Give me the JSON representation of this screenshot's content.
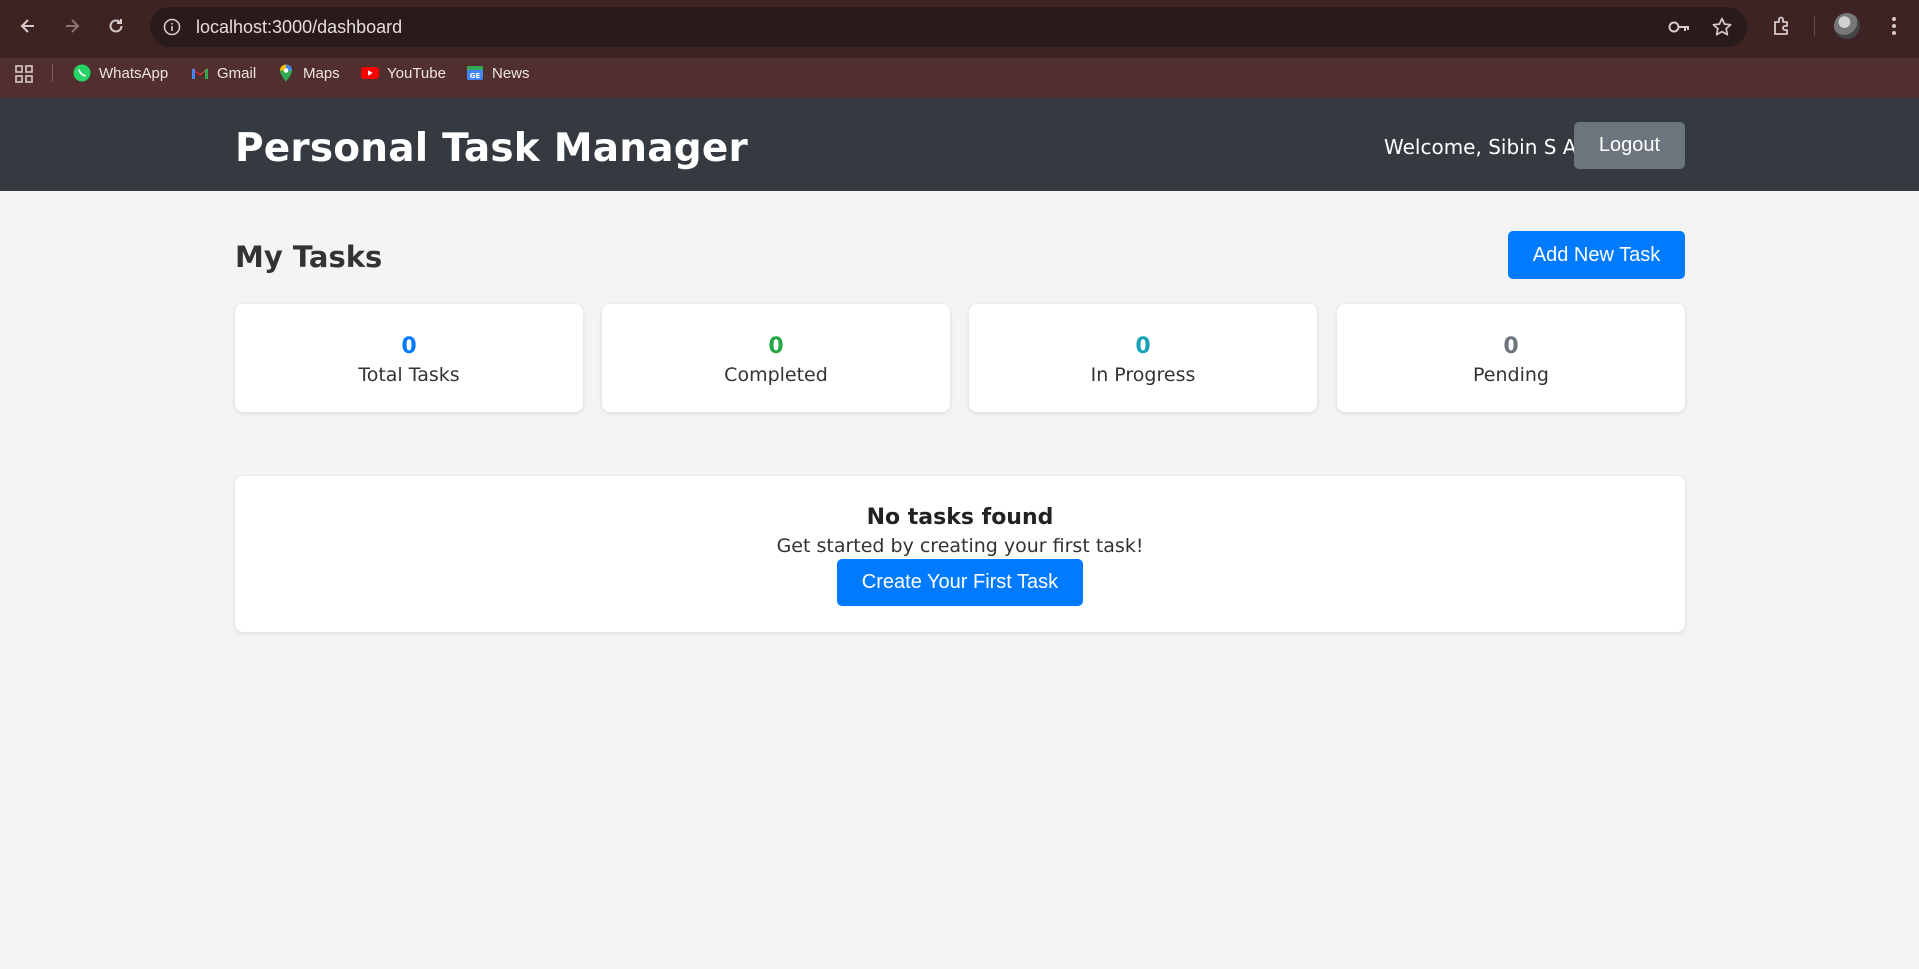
{
  "browser": {
    "url": "localhost:3000/dashboard",
    "bookmarks": [
      {
        "label": "WhatsApp",
        "icon": "whatsapp-icon"
      },
      {
        "label": "Gmail",
        "icon": "gmail-icon"
      },
      {
        "label": "Maps",
        "icon": "maps-icon"
      },
      {
        "label": "YouTube",
        "icon": "youtube-icon"
      },
      {
        "label": "News",
        "icon": "news-icon"
      }
    ]
  },
  "header": {
    "title": "Personal Task Manager",
    "welcome": "Welcome, Sibin S A",
    "logout_label": "Logout"
  },
  "main": {
    "heading": "My Tasks",
    "add_button_label": "Add New Task",
    "stats": [
      {
        "value": "0",
        "label": "Total Tasks",
        "color": "#007bff"
      },
      {
        "value": "0",
        "label": "Completed",
        "color": "#28a745"
      },
      {
        "value": "0",
        "label": "In Progress",
        "color": "#17a2b8"
      },
      {
        "value": "0",
        "label": "Pending",
        "color": "#6c757d"
      }
    ],
    "empty_state": {
      "title": "No tasks found",
      "subtitle": "Get started by creating your first task!",
      "button_label": "Create Your First Task"
    }
  },
  "colors": {
    "primary": "#007bff",
    "header_bg": "#343a40",
    "secondary": "#6c757d"
  }
}
